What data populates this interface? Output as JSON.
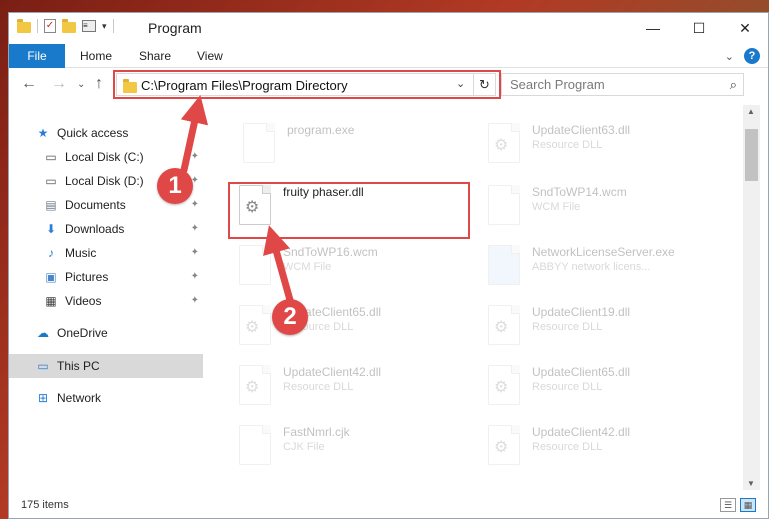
{
  "window": {
    "title": "Program",
    "controls": {
      "minimize": "—",
      "maximize": "☐",
      "close": "✕"
    }
  },
  "ribbon": {
    "tabs": [
      "File",
      "Home",
      "Share",
      "View"
    ]
  },
  "address": {
    "path": "C:\\Program Files\\Program Directory"
  },
  "search": {
    "placeholder": "Search Program"
  },
  "sidebar": {
    "items": [
      {
        "label": "Quick access",
        "icon": "star-icon",
        "pinned": false
      },
      {
        "label": "Local Disk (C:)",
        "icon": "drive-icon",
        "pinned": true
      },
      {
        "label": "Local Disk (D:)",
        "icon": "drive-icon",
        "pinned": true
      },
      {
        "label": "Documents",
        "icon": "documents-icon",
        "pinned": true
      },
      {
        "label": "Downloads",
        "icon": "download-icon",
        "pinned": true
      },
      {
        "label": "Music",
        "icon": "music-icon",
        "pinned": true
      },
      {
        "label": "Pictures",
        "icon": "pictures-icon",
        "pinned": true
      },
      {
        "label": "Videos",
        "icon": "videos-icon",
        "pinned": true
      },
      {
        "label": "OneDrive",
        "icon": "cloud-icon",
        "pinned": false
      },
      {
        "label": "This PC",
        "icon": "computer-icon",
        "pinned": false,
        "selected": true
      },
      {
        "label": "Network",
        "icon": "network-icon",
        "pinned": false
      }
    ]
  },
  "files": [
    {
      "name": "program.exe",
      "type": "",
      "faded": true
    },
    {
      "name": "UpdateClient63.dll",
      "type": "Resource DLL",
      "faded": true
    },
    {
      "name": "fruity phaser.dll",
      "type": "",
      "faded": false,
      "highlighted": true
    },
    {
      "name": "SndToWP14.wcm",
      "type": "WCM File",
      "faded": true
    },
    {
      "name": "SndToWP16.wcm",
      "type": "WCM File",
      "faded": true
    },
    {
      "name": "NetworkLicenseServer.exe",
      "type": "ABBYY network licens...",
      "faded": true
    },
    {
      "name": "UpdateClient65.dll",
      "type": "Resource DLL",
      "faded": true
    },
    {
      "name": "UpdateClient19.dll",
      "type": "Resource DLL",
      "faded": true
    },
    {
      "name": "UpdateClient42.dll",
      "type": "Resource DLL",
      "faded": true
    },
    {
      "name": "UpdateClient65.dll",
      "type": "Resource DLL",
      "faded": true
    },
    {
      "name": "FastNmrl.cjk",
      "type": "CJK File",
      "faded": true
    },
    {
      "name": "UpdateClient42.dll",
      "type": "Resource DLL",
      "faded": true
    }
  ],
  "status": {
    "item_count": "175 items"
  },
  "callouts": [
    "1",
    "2"
  ],
  "colors": {
    "accent": "#1979ca",
    "highlight": "#e04848",
    "selected_nav": "#d9d9d9"
  }
}
